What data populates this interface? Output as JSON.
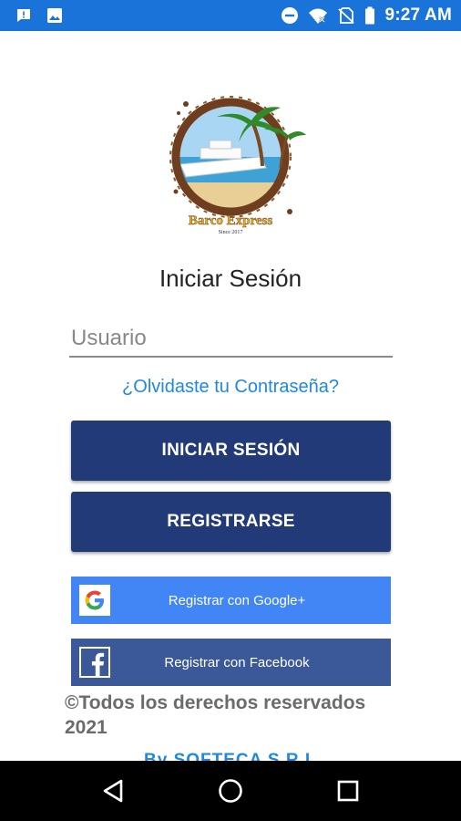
{
  "status_bar": {
    "time": "9:27 AM",
    "icons_left": [
      "message-notification-icon",
      "image-notification-icon"
    ],
    "icons_right": [
      "do-not-disturb-icon",
      "wifi-icon",
      "no-sim-icon",
      "battery-icon"
    ],
    "background": "#1a73d9"
  },
  "logo": {
    "brand": "Barco Express",
    "since": "Since 2017"
  },
  "login": {
    "title": "Iniciar Sesión",
    "username_placeholder": "Usuario",
    "username_value": "",
    "forgot_password": "¿Olvidaste tu Contraseña?",
    "login_button": "INICIAR SESIÓN",
    "register_button": "REGISTRARSE",
    "google_button": "Registrar con Google+",
    "facebook_button": "Registrar con Facebook"
  },
  "footer": {
    "copyright": "©Todos los derechos reservados 2021",
    "partial_link": "By SOFTECA S.R.L."
  },
  "colors": {
    "primary_button": "#223a78",
    "google": "#4285f4",
    "facebook": "#3b5998",
    "link": "#1e88e5"
  },
  "nav_bar": {
    "buttons": [
      "back-icon",
      "home-icon",
      "recents-icon"
    ]
  }
}
